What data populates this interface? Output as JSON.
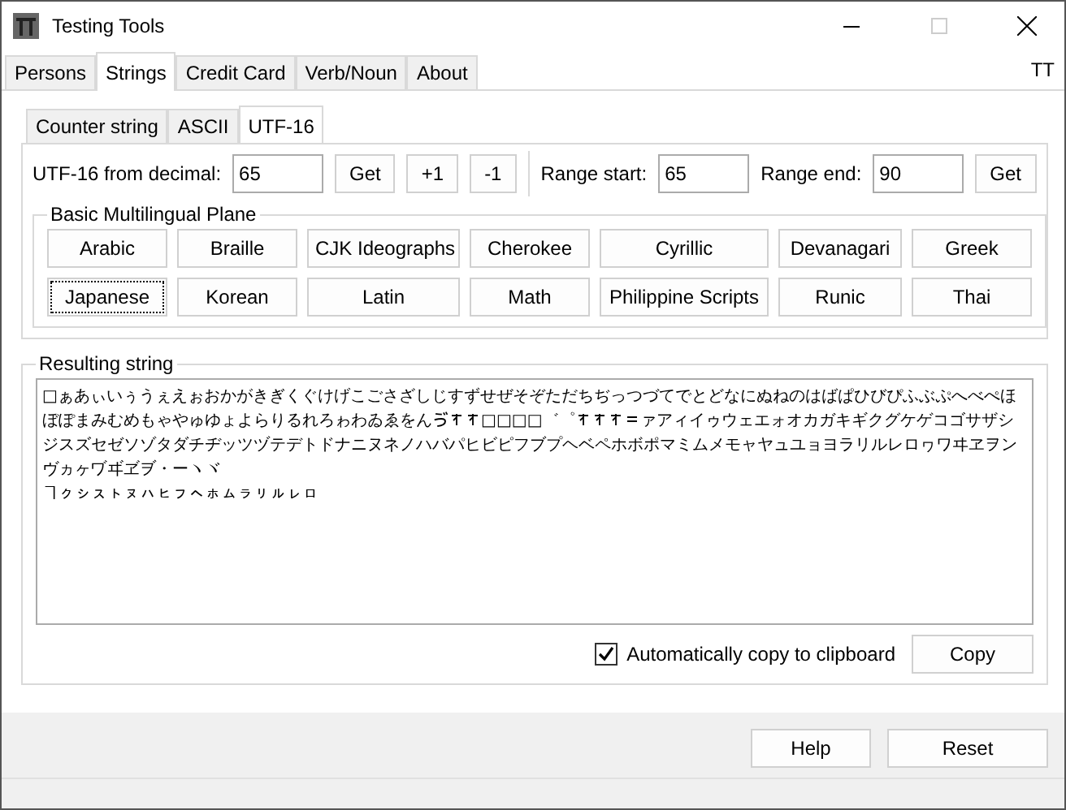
{
  "window": {
    "title": "Testing Tools",
    "badge": "TT"
  },
  "tabs": [
    {
      "label": "Persons",
      "selected": false
    },
    {
      "label": "Strings",
      "selected": true
    },
    {
      "label": "Credit Card",
      "selected": false
    },
    {
      "label": "Verb/Noun",
      "selected": false
    },
    {
      "label": "About",
      "selected": false
    }
  ],
  "subtabs": [
    {
      "label": "Counter string",
      "selected": false
    },
    {
      "label": "ASCII",
      "selected": false
    },
    {
      "label": "UTF-16",
      "selected": true
    }
  ],
  "decimal": {
    "label": "UTF-16 from decimal:",
    "value": "65",
    "buttons": [
      "Get",
      "+1",
      "-1"
    ]
  },
  "range": {
    "start_label": "Range start:",
    "start": "65",
    "end_label": "Range end:",
    "end": "90",
    "button": "Get"
  },
  "plane": {
    "title": "Basic Multilingual Plane",
    "buttons": [
      {
        "label": "Arabic",
        "selected": false
      },
      {
        "label": "Braille",
        "selected": false
      },
      {
        "label": "CJK Ideographs",
        "selected": false
      },
      {
        "label": "Cherokee",
        "selected": false
      },
      {
        "label": "Cyrillic",
        "selected": false
      },
      {
        "label": "Devanagari",
        "selected": false
      },
      {
        "label": "Greek",
        "selected": false
      },
      {
        "label": "Japanese",
        "selected": true
      },
      {
        "label": "Korean",
        "selected": false
      },
      {
        "label": "Latin",
        "selected": false
      },
      {
        "label": "Math",
        "selected": false
      },
      {
        "label": "Philippine Scripts",
        "selected": false
      },
      {
        "label": "Runic",
        "selected": false
      },
      {
        "label": "Thai",
        "selected": false
      }
    ]
  },
  "result": {
    "title": "Resulting string",
    "paragraphs": [
      [
        {
          "kind": "text",
          "text": "□ぁあぃいぅうぇえぉおかがきぎくぐけげこごさざしじすずせぜそぞただちぢっつづてでとどなにぬねのはばぱひびぴふぶぷへべぺほぼぽまみむめもゃやゅゆょよらりるれろゎわゐゑをんゔ"
        },
        {
          "kind": "sign"
        },
        {
          "kind": "sign"
        },
        {
          "kind": "text",
          "text": "□□□□゛゜"
        },
        {
          "kind": "sign"
        },
        {
          "kind": "sign"
        },
        {
          "kind": "sign"
        },
        {
          "kind": "dash"
        },
        {
          "kind": "text",
          "text": "ァアィイゥウェエォオカガキギクグケゲコゴサザシジスズセゼソゾタダチヂッツヅテデトドナニヌネノハバパヒビピフブプヘベペホボポマミムメモャヤュユョヨラリルレロヮワヰヱヲンヴヵヶヷヸヹヺ・ーヽヾ"
        }
      ],
      [
        {
          "kind": "text",
          "text": "ヿㇰㇱㇲㇳㇴㇵㇶㇷㇸㇹㇺㇻㇼㇽㇾㇿ"
        }
      ]
    ],
    "auto_copy": {
      "label": "Automatically copy to clipboard",
      "checked": true
    },
    "copy": "Copy"
  },
  "footer": [
    "Help",
    "Reset"
  ]
}
